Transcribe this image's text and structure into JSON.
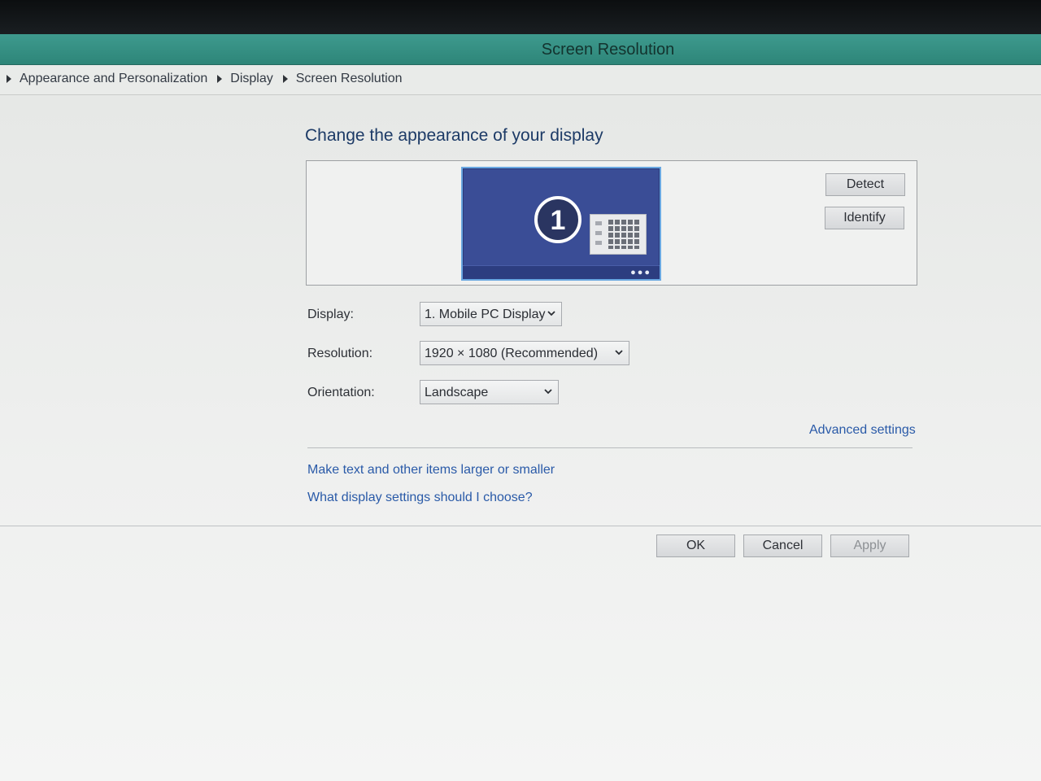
{
  "window": {
    "title": "Screen Resolution"
  },
  "breadcrumb": [
    "Appearance and Personalization",
    "Display",
    "Screen Resolution"
  ],
  "main": {
    "heading": "Change the appearance of your display",
    "monitor_number": "1",
    "detect_label": "Detect",
    "identify_label": "Identify"
  },
  "form": {
    "display_label": "Display:",
    "display_value": "1. Mobile PC Display",
    "resolution_label": "Resolution:",
    "resolution_value": "1920 × 1080 (Recommended)",
    "orientation_label": "Orientation:",
    "orientation_value": "Landscape"
  },
  "links": {
    "advanced": "Advanced settings",
    "text_size": "Make text and other items larger or smaller",
    "help": "What display settings should I choose?"
  },
  "buttons": {
    "ok": "OK",
    "cancel": "Cancel",
    "apply": "Apply"
  },
  "colors": {
    "titlebar": "#3e9a8e",
    "monitor": "#3a4d96",
    "link": "#2a5aa8"
  },
  "icons": [
    "breadcrumb-arrow-icon",
    "monitor-icon",
    "chevron-down-icon",
    "grid-icon"
  ]
}
